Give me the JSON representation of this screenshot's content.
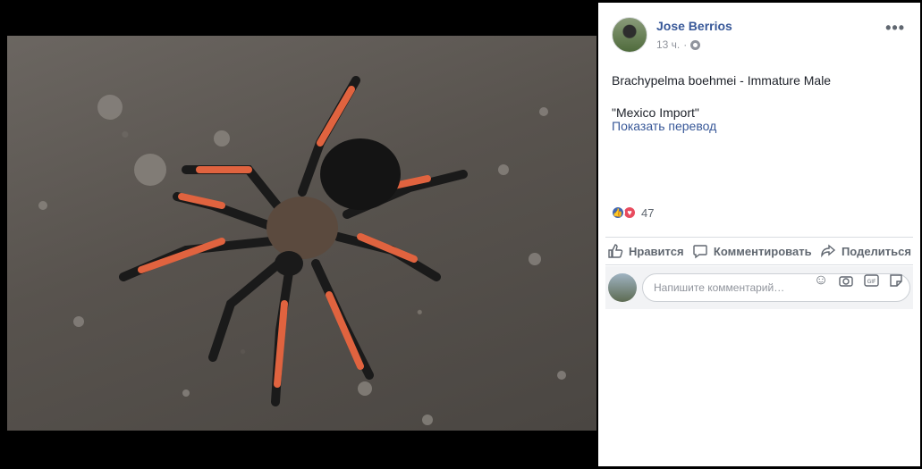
{
  "post": {
    "author": "Jose Berrios",
    "time": "13 ч.",
    "caption_line1": "Brachypelma boehmei - Immature Male",
    "caption_line2": "\"Mexico Import\"",
    "translate": "Показать перевод",
    "reaction_count": "47"
  },
  "actions": {
    "like": "Нравится",
    "comment": "Комментировать",
    "share": "Поделиться"
  },
  "comment": {
    "placeholder": "Напишите комментарий…"
  },
  "colors": {
    "link": "#385898",
    "like": "#4167b1",
    "love": "#e84b5e"
  }
}
